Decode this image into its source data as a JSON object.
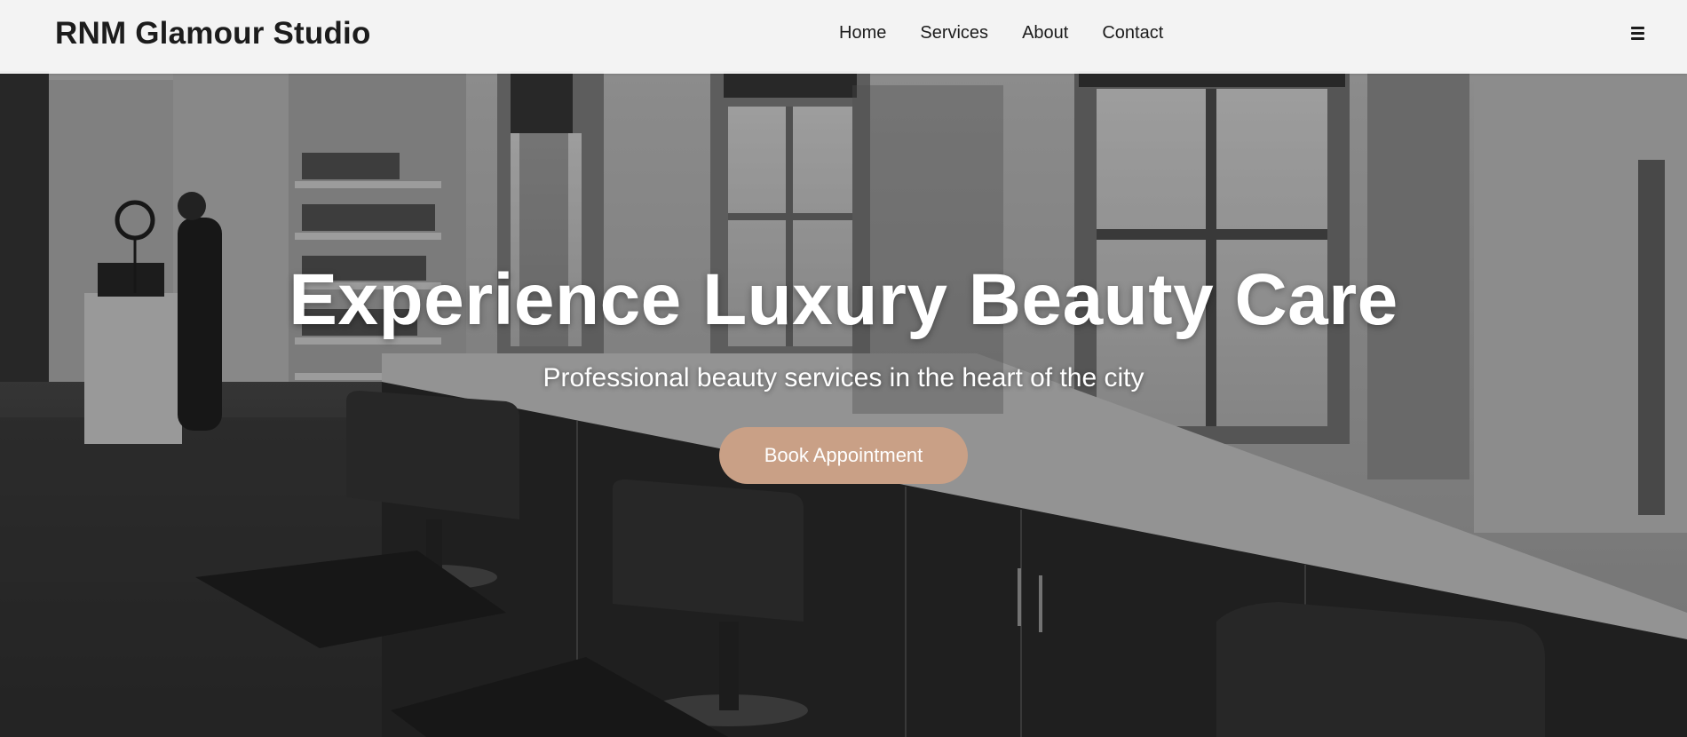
{
  "navbar": {
    "brand": "RNM Glamour Studio",
    "links": [
      "Home",
      "Services",
      "About",
      "Contact"
    ],
    "menu_icon": "hamburger-menu-icon"
  },
  "hero": {
    "background_image": "black-and-white photo of a hair salon interior with styling chairs, mirrors, windows and product shelves",
    "title": "Experience Luxury Beauty Care",
    "subtitle": "Professional beauty services in the heart of the city",
    "cta_label": "Book Appointment"
  },
  "colors": {
    "accent": "#c9a086",
    "navbar_bg": "#f7f7f7",
    "text_dark": "#1c1c1c",
    "hero_text": "#ffffff"
  }
}
